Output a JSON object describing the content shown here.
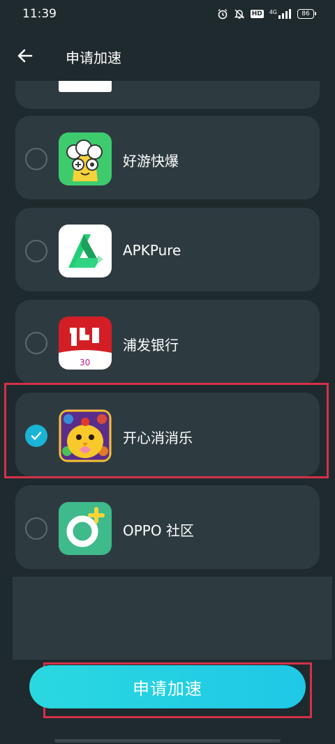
{
  "status_bar": {
    "time": "11:39",
    "signal": "4G",
    "battery": "86",
    "hd": "HD"
  },
  "header": {
    "title": "申请加速",
    "back_icon": "arrow-left-icon"
  },
  "apps": [
    {
      "name": "好游快爆",
      "checked": false,
      "icon": "haoyou-kuaibao-icon"
    },
    {
      "name": "APKPure",
      "checked": false,
      "icon": "apkpure-icon"
    },
    {
      "name": "浦发银行",
      "checked": false,
      "icon": "spdb-bank-icon"
    },
    {
      "name": "开心消消乐",
      "checked": true,
      "icon": "happy-elimination-icon"
    },
    {
      "name": "OPPO 社区",
      "checked": false,
      "icon": "oppo-community-icon"
    }
  ],
  "apply_button": {
    "label": "申请加速"
  },
  "colors": {
    "background": "#1f2a2e",
    "card": "#2d3b41",
    "accent": "#1ab4d6",
    "highlight": "#d63049"
  }
}
